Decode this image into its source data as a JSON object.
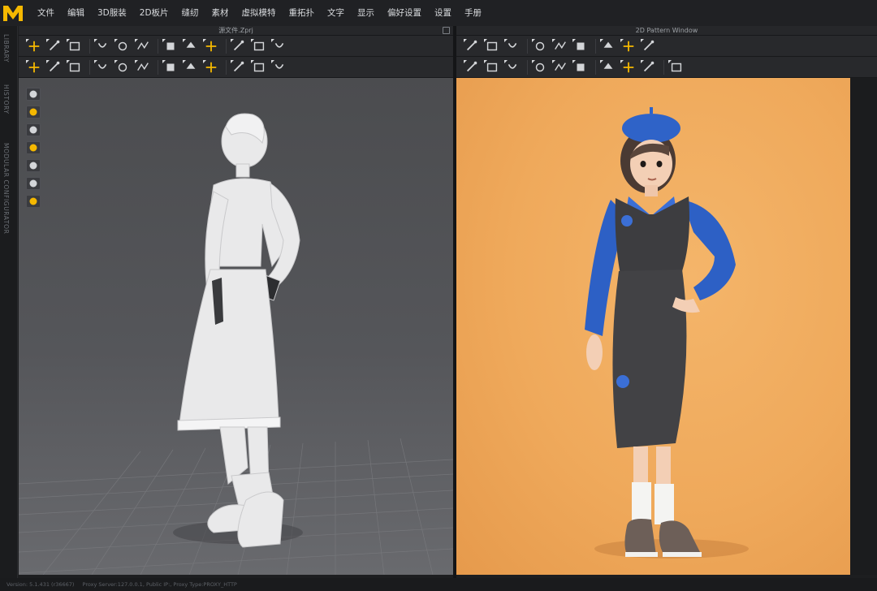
{
  "app": {
    "logo_icon": "marvelous-m-logo",
    "accent_color": "#f5b800"
  },
  "menu": {
    "items": [
      "文件",
      "编辑",
      "3D服装",
      "2D板片",
      "缝纫",
      "素材",
      "虚拟模特",
      "重拓扑",
      "文字",
      "显示",
      "偏好设置",
      "设置",
      "手册"
    ]
  },
  "side_tabs": [
    "LIBRARY",
    "HISTORY",
    "MODULAR CONFIGURATOR"
  ],
  "windows": {
    "left_title": "源文件.Zprj",
    "right_title": "2D Pattern Window"
  },
  "toolbar_icons": {
    "row1_left": [
      "transform-pattern-icon",
      "select-move-icon",
      "segment-sewing-icon",
      "free-sewing-icon",
      "tack-icon",
      "edit-pin-icon",
      "steam-icon",
      "fold-arrangement-icon",
      "strengthen-icon",
      "shrinkage-icon",
      "fabric-simulation-icon",
      "grid-icon"
    ],
    "row2_left": [
      "avatar-measure-icon",
      "line-tool-icon",
      "curve-tool-icon",
      "zipper-icon",
      "button-icon",
      "topstitch-icon",
      "puckering-icon",
      "trim-icon",
      "texture-icon",
      "graphic-icon",
      "style-line-icon",
      "arrangement-point-icon"
    ],
    "row1_right": [
      "polygon-icon",
      "rectangle-icon",
      "circle-icon",
      "internal-polygon-icon",
      "dart-icon",
      "fold-icon",
      "tracing-icon",
      "pattern-view-icon",
      "grid-view-icon"
    ],
    "row2_right": [
      "segment-sew-icon",
      "free-sew-icon",
      "check-sewing-icon",
      "tack-on-icon",
      "brush-icon",
      "fabric-icon",
      "edit-texture-icon",
      "graphic-2d-icon",
      "measure-icon",
      "dashed-line-icon"
    ]
  },
  "side_tool_icons": [
    "garment-icon",
    "fabric-swatch-icon",
    "avatar-icon",
    "folder-icon",
    "eraser-icon",
    "user-icon",
    "globe-icon"
  ],
  "status": {
    "version": "Version: 5.1.431 (r36667)",
    "proxy": "Proxy Server:127.0.0.1, Public IP:, Proxy Type:PROXY_HTTP"
  }
}
